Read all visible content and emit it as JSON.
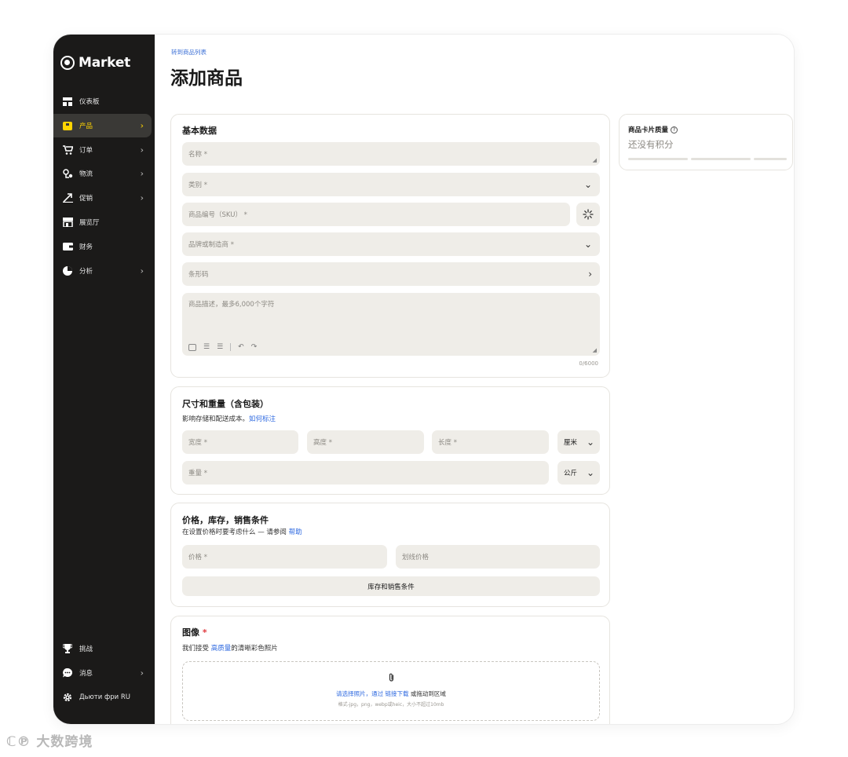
{
  "app": {
    "brand": "Market"
  },
  "sidebar": {
    "items": [
      {
        "label": "仪表板",
        "icon": "dashboard-icon",
        "has_chevron": false,
        "active": false
      },
      {
        "label": "产品",
        "icon": "product-icon",
        "has_chevron": true,
        "active": true
      },
      {
        "label": "订单",
        "icon": "cart-icon",
        "has_chevron": true,
        "active": false
      },
      {
        "label": "物流",
        "icon": "logistics-icon",
        "has_chevron": true,
        "active": false
      },
      {
        "label": "促销",
        "icon": "promo-icon",
        "has_chevron": true,
        "active": false
      },
      {
        "label": "展览厅",
        "icon": "storefront-icon",
        "has_chevron": false,
        "active": false
      },
      {
        "label": "财务",
        "icon": "wallet-icon",
        "has_chevron": false,
        "active": false
      },
      {
        "label": "分析",
        "icon": "pie-chart-icon",
        "has_chevron": true,
        "active": false
      }
    ],
    "bottom_items": [
      {
        "label": "挑战",
        "icon": "trophy-icon",
        "has_chevron": false
      },
      {
        "label": "消息",
        "icon": "chat-icon",
        "has_chevron": true
      },
      {
        "label": "Дьюти фри RU",
        "icon": "gear-icon",
        "has_chevron": false
      }
    ]
  },
  "header": {
    "breadcrumb": "转到商品列表",
    "title": "添加商品"
  },
  "basic": {
    "title": "基本数据",
    "name_placeholder": "名称 *",
    "category_placeholder": "类别 *",
    "sku_placeholder": "商品编号（SKU） *",
    "brand_placeholder": "品牌或制造商 *",
    "barcode_placeholder": "条形码",
    "description_placeholder": "商品描述，最多6,000个字符",
    "counter": "0/6000"
  },
  "dimensions": {
    "title": "尺寸和重量（含包装）",
    "subtitle": "影响存储和配送成本。",
    "link": "如何标注",
    "width_placeholder": "宽度 *",
    "height_placeholder": "高度 *",
    "length_placeholder": "长度 *",
    "length_unit": "厘米",
    "weight_placeholder": "重量 *",
    "weight_unit": "公斤"
  },
  "pricing": {
    "title": "价格，库存，销售条件",
    "subtitle": "在设置价格时要考虑什么 — 请参阅",
    "link": "帮助",
    "price_placeholder": "价格 *",
    "strike_placeholder": "划线价格",
    "stock_button": "库存和销售条件"
  },
  "images": {
    "title": "图像",
    "required_mark": "*",
    "sub_prefix": "我们接受",
    "sub_link": "高质量",
    "sub_suffix": "的清晰彩色照片",
    "upload_link1": "请选择照片，通过",
    "upload_link2": "链接下载",
    "upload_text": "或拖动到区域",
    "upload_hint": "格式-jpg，png，webp或heic，大小不超过10mb"
  },
  "quality": {
    "title": "商品卡片质量",
    "value": "还没有积分"
  },
  "watermark": "大数跨境"
}
